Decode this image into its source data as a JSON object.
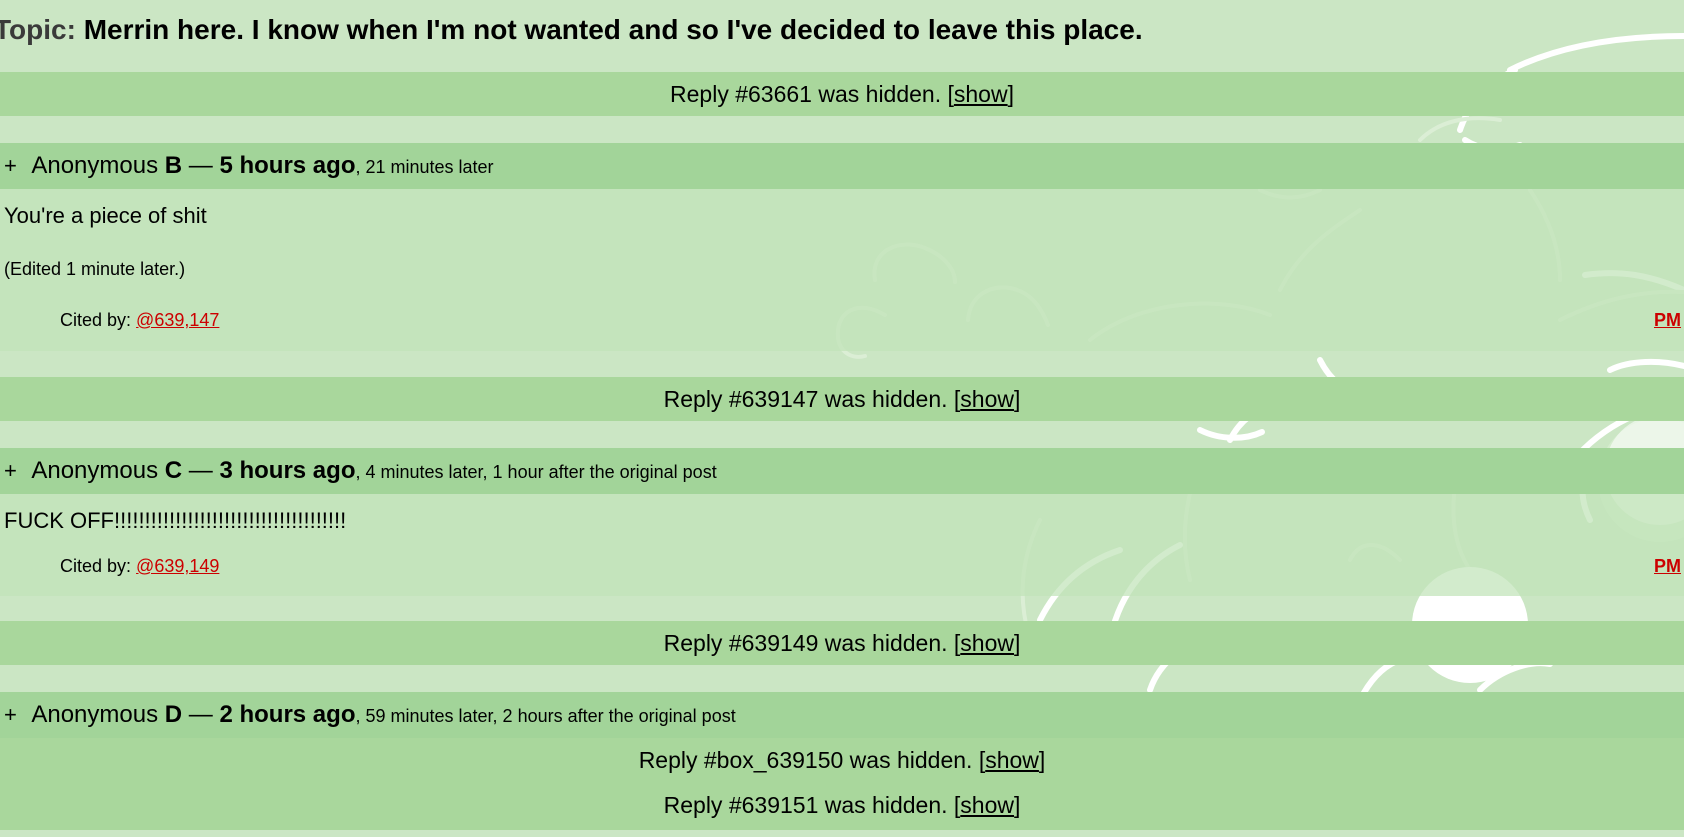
{
  "topic": {
    "label": "Topic:",
    "title": "Merrin here. I know when I'm not wanted and so I've decided to leave this place."
  },
  "hidden_template": {
    "suffix": " was hidden. [",
    "show_label": "show",
    "close": "]"
  },
  "hidden_1": {
    "prefix": "Reply #63661"
  },
  "post_b": {
    "expander": "+",
    "name": "Anonymous",
    "letter": "B",
    "dash": "—",
    "time": "5 hours ago",
    "later": ", 21 minutes later",
    "text": "You're a piece of shit",
    "edited": "(Edited 1 minute later.)",
    "cited_label": "Cited by: ",
    "cited_link": "@639,147",
    "pm": "PM"
  },
  "hidden_2": {
    "prefix": "Reply #639147"
  },
  "post_c": {
    "expander": "+",
    "name": "Anonymous",
    "letter": "C",
    "dash": "—",
    "time": "3 hours ago",
    "later": ", 4 minutes later, 1 hour after the original post",
    "text": "FUCK OFF!!!!!!!!!!!!!!!!!!!!!!!!!!!!!!!!!!!!!!",
    "cited_label": "Cited by: ",
    "cited_link": "@639,149",
    "pm": "PM"
  },
  "hidden_3": {
    "prefix": "Reply #639149"
  },
  "post_d": {
    "expander": "+",
    "name": "Anonymous",
    "letter": "D",
    "dash": "—",
    "time": "2 hours ago",
    "later": ", 59 minutes later, 2 hours after the original post"
  },
  "hidden_4": {
    "prefix": "Reply #box_639150"
  },
  "hidden_5": {
    "prefix": "Reply #639151"
  },
  "colors": {
    "background": "#cbe6c4",
    "hidden_bar": "#a9d79c",
    "post_header": "#a2d499",
    "link_red": "#cc0000"
  }
}
